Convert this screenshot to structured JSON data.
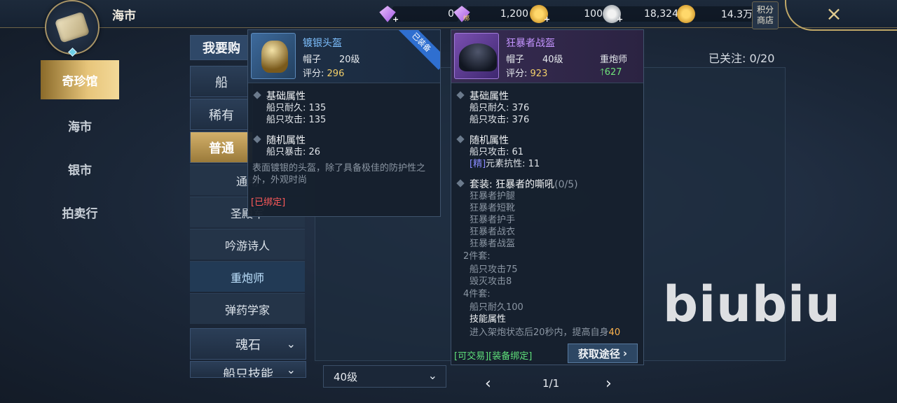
{
  "header": {
    "title": "海市",
    "shop_button": "积分\n商店",
    "currencies": [
      {
        "icon": "purple-diamond-icon",
        "value": "0"
      },
      {
        "icon": "bound-purple-diamond-icon",
        "tag": "绑",
        "value": "1,200"
      },
      {
        "icon": "gold-coin-icon",
        "value": "100"
      },
      {
        "icon": "silver-coin-icon",
        "value": "18,324"
      },
      {
        "icon": "gold-coin-stack-icon",
        "value": "14.3万"
      }
    ],
    "close_icon": "×"
  },
  "left_nav": {
    "items": [
      {
        "label": "奇珍馆",
        "active": true
      },
      {
        "label": "海市"
      },
      {
        "label": "银市"
      },
      {
        "label": "拍卖行"
      }
    ]
  },
  "categories": {
    "tab_label": "我要购",
    "items": [
      "船",
      "稀有",
      "普通"
    ],
    "sub_items": [
      "通用",
      "圣殿军",
      "吟游诗人",
      "重炮师",
      "弹药学家"
    ],
    "soulstone": "魂石",
    "ship_skill": "船只技能"
  },
  "main": {
    "follow_count": "已关注: 0/20",
    "level_select": "40级",
    "pager": "1/1",
    "watermark": "biubiu"
  },
  "tooltip_equipped": {
    "name": "镀银头盔",
    "ribbon": "已装备",
    "slot": "帽子",
    "level": "20级",
    "score_label": "评分:",
    "score": "296",
    "base_title": "基础属性",
    "base_stats": [
      "船只耐久:  135",
      "船只攻击:  135"
    ],
    "random_title": "随机属性",
    "random_stats": [
      "船只暴击:  26"
    ],
    "description": "表面镀银的头盔，除了具备极佳的防护性之外，外观时尚",
    "bound": "[已绑定]"
  },
  "tooltip_compare": {
    "name": "狂暴者战盔",
    "slot": "帽子",
    "level": "40级",
    "class": "重炮师",
    "score_label": "评分:",
    "score": "923",
    "delta": "627",
    "base_title": "基础属性",
    "base_stats": [
      "船只耐久:  376",
      "船只攻击:  376"
    ],
    "random_title": "随机属性",
    "random_stat_1": "船只攻击:  61",
    "refine_tag": "[精]",
    "refine_stat": "元素抗性:  11",
    "set_title": "套装:  狂暴者的嘶吼",
    "set_count": "(0/5)",
    "set_items": [
      "狂暴者护腿",
      "狂暴者短靴",
      "狂暴者护手",
      "狂暴者战衣",
      "狂暴者战盔"
    ],
    "set2_title": "2件套:",
    "set2_bonus": [
      "船只攻击75",
      "毁灭攻击8"
    ],
    "set4_title": "4件套:",
    "set4_bonus": [
      "船只耐久100"
    ],
    "skill_title": "技能属性",
    "skill_text": "进入架炮状态后20秒内，提高自身",
    "skill_value": "40",
    "trade": "[可交易][装备绑定]",
    "source_button": "获取途径"
  },
  "colors": {
    "gold_accent": "#e7c57a",
    "blue_item": "#7ec0ff",
    "purple_item": "#c494ff",
    "positive": "#6fe37a",
    "bound_red": "#ff5a5a"
  }
}
